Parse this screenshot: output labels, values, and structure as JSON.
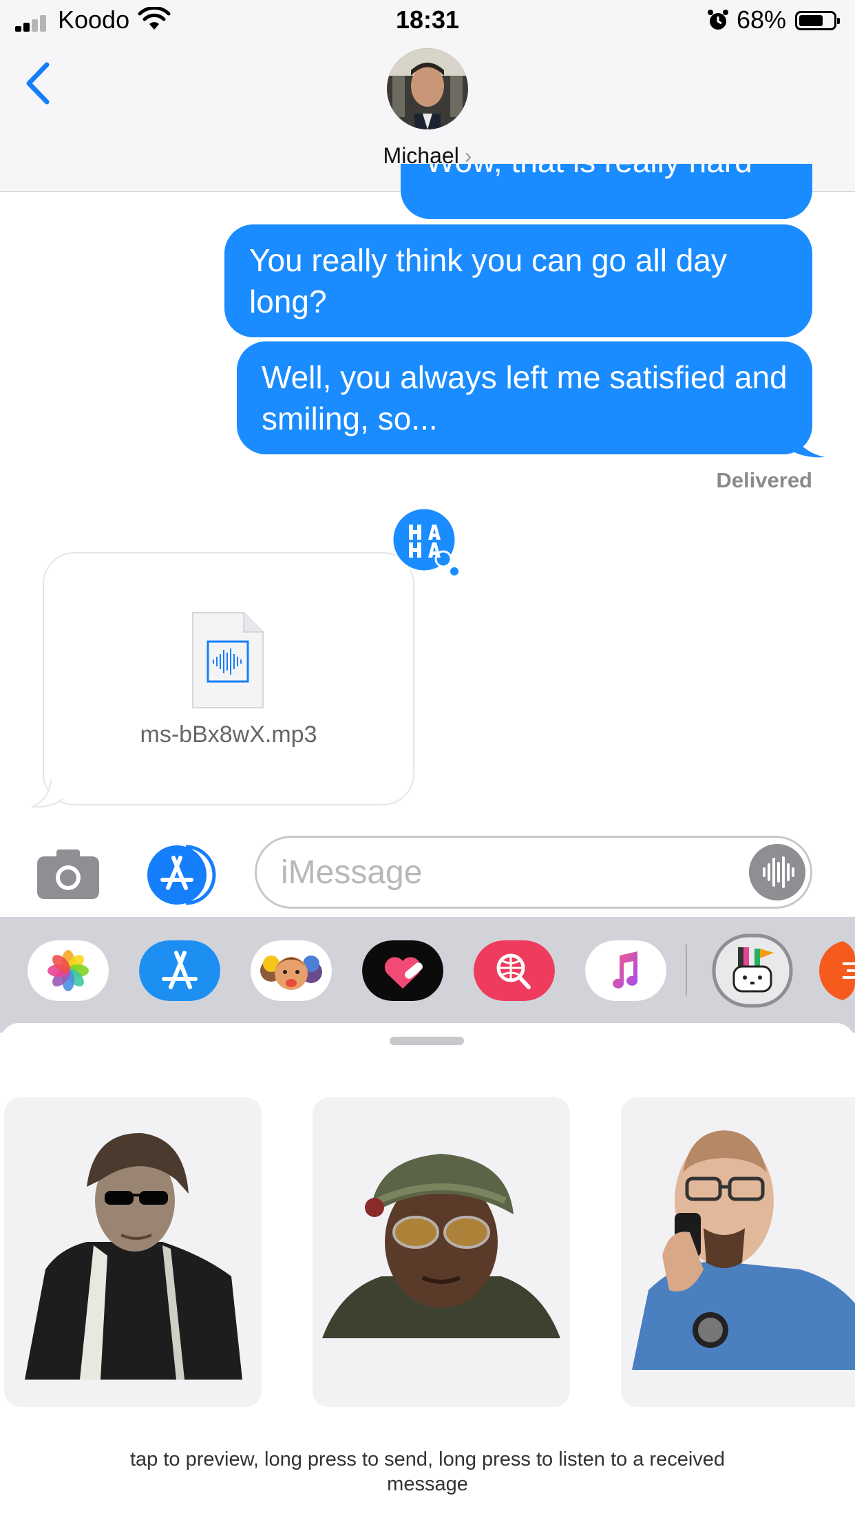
{
  "status_bar": {
    "carrier": "Koodo",
    "time": "18:31",
    "battery_percent": "68%",
    "battery_level": 0.68
  },
  "header": {
    "contact_name": "Michael",
    "chevron": "›"
  },
  "messages": [
    {
      "text": "Wow, that is really hard",
      "sender": "me",
      "partially_visible": true
    },
    {
      "text": "You really think you can go all day long?",
      "sender": "me"
    },
    {
      "text": "Well, you always left me satisfied and smiling, so...",
      "sender": "me"
    }
  ],
  "delivery_status": "Delivered",
  "tapback": {
    "icon": "haha-icon",
    "label": "HA HA"
  },
  "attachment": {
    "file_name": "ms-bBx8wX.mp3",
    "icon": "audio-file-icon"
  },
  "input": {
    "placeholder": "iMessage"
  },
  "app_drawer": [
    {
      "name": "photos",
      "icon": "photos-icon"
    },
    {
      "name": "app-store",
      "icon": "app-store-icon"
    },
    {
      "name": "memoji",
      "icon": "memoji-icon"
    },
    {
      "name": "digital-touch",
      "icon": "heart-touch-icon"
    },
    {
      "name": "images-search",
      "icon": "globe-search-icon"
    },
    {
      "name": "music",
      "icon": "music-note-icon"
    },
    {
      "name": "sticker-app",
      "icon": "bunny-icon",
      "selected": true
    },
    {
      "name": "more-app",
      "icon": "orange-app-icon"
    }
  ],
  "stickers": [
    {
      "name": "sunglasses-guy-sticker"
    },
    {
      "name": "soldier-sticker"
    },
    {
      "name": "walkie-talkie-man-sticker"
    }
  ],
  "hint": "tap to preview, long press to send, long press to listen to a received message",
  "colors": {
    "imessage_blue": "#1a8cff",
    "system_blue": "#147efb",
    "drawer_bg": "#d1d3d9"
  }
}
